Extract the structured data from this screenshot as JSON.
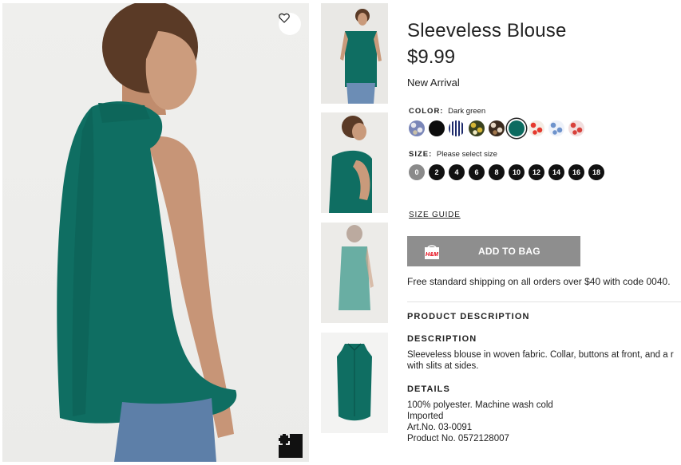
{
  "product": {
    "title": "Sleeveless Blouse",
    "price": "$9.99",
    "badge": "New Arrival"
  },
  "color": {
    "label": "COLOR:",
    "value": "Dark green",
    "swatches": [
      {
        "name": "floral-light",
        "colors": [
          "#e8e8ee",
          "#7a86b8",
          "#c9c0a8"
        ]
      },
      {
        "name": "black",
        "colors": [
          "#0d0d0d"
        ]
      },
      {
        "name": "striped-navy",
        "colors": [
          "#1d2a6b",
          "#ffffff"
        ]
      },
      {
        "name": "yellow-floral",
        "colors": [
          "#d5b636",
          "#3a4220",
          "#efe8c0"
        ]
      },
      {
        "name": "leopard",
        "colors": [
          "#e5d6c4",
          "#3a2a1e",
          "#a0764c"
        ]
      },
      {
        "name": "dark-green",
        "colors": [
          "#0c6b60"
        ]
      },
      {
        "name": "red-floral",
        "colors": [
          "#e5392d",
          "#f4ece4"
        ]
      },
      {
        "name": "blue-floral",
        "colors": [
          "#6e93cc",
          "#eef2fa"
        ]
      },
      {
        "name": "red-pattern",
        "colors": [
          "#d8413a",
          "#f2dede"
        ]
      }
    ],
    "selected_index": 5
  },
  "size": {
    "label": "SIZE:",
    "prompt": "Please select size",
    "options": [
      "0",
      "2",
      "4",
      "6",
      "8",
      "10",
      "12",
      "14",
      "16",
      "18"
    ],
    "disabled": [
      "0"
    ]
  },
  "size_guide": "SIZE GUIDE",
  "add_to_bag": "ADD TO BAG",
  "bag_logo": "H&M",
  "shipping": "Free standard shipping on all orders over $40 with code 0040.",
  "sections": {
    "product_description": "PRODUCT DESCRIPTION",
    "description_head": "DESCRIPTION",
    "description_line1": "Sleeveless blouse in woven fabric. Collar, buttons at front, and a r",
    "description_line2": "with slits at sides.",
    "details_head": "DETAILS",
    "details": [
      "100% polyester. Machine wash cold",
      "Imported",
      "Art.No. 03-0091",
      "Product No. 0572128007"
    ]
  },
  "brand_colors": {
    "blouse_green": "#0f6e62",
    "button_gray": "#8e8e8e",
    "text": "#222222"
  }
}
